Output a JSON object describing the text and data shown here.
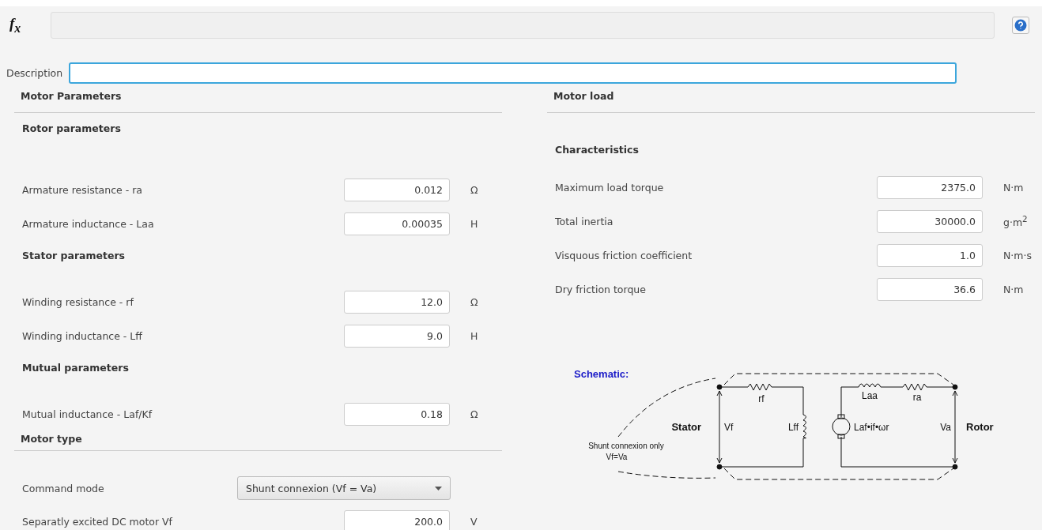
{
  "formula_bar": {
    "label": "f$_{x}$"
  },
  "description": {
    "label": "Description"
  },
  "left": {
    "title": "Motor Parameters",
    "items": [
      {
        "kind": "subheading",
        "label": "Rotor parameters"
      },
      {
        "kind": "field",
        "label": "Armature resistance - ra",
        "value": "0.012",
        "unit": "Ω"
      },
      {
        "kind": "field",
        "label": "Armature inductance - Laa",
        "value": "0.00035",
        "unit": "H"
      },
      {
        "kind": "subheading",
        "label": "Stator parameters"
      },
      {
        "kind": "field",
        "label": "Winding resistance - rf",
        "value": "12.0",
        "unit": "Ω"
      },
      {
        "kind": "field",
        "label": "Winding inductance - Lff",
        "value": "9.0",
        "unit": "H"
      },
      {
        "kind": "subheading",
        "label": "Mutual parameters"
      },
      {
        "kind": "field",
        "label": "Mutual inductance - Laf/Kf",
        "value": "0.18",
        "unit": "Ω"
      },
      {
        "kind": "heading",
        "label": "Motor type"
      },
      {
        "kind": "dropdown",
        "label": "Command mode",
        "value": "Shunt connexion (Vf = Va)"
      },
      {
        "kind": "field",
        "label": "Separatly excited DC motor Vf",
        "value": "200.0",
        "unit": "V"
      }
    ]
  },
  "right": {
    "title": "Motor load",
    "items": [
      {
        "kind": "subheading",
        "label": "Characteristics"
      },
      {
        "kind": "field",
        "label": "Maximum load torque",
        "value": "2375.0",
        "unit": "N·m"
      },
      {
        "kind": "field",
        "label": "Total inertia",
        "value": "30000.0",
        "unit": "g·m$^{2}$"
      },
      {
        "kind": "field",
        "label": "Visquous friction coefficient",
        "value": "1.0",
        "unit": "N·m·s"
      },
      {
        "kind": "field",
        "label": "Dry friction torque",
        "value": "36.6",
        "unit": "N·m"
      }
    ]
  },
  "schematic": {
    "title": "Schematic:",
    "rf": "rf",
    "laa": "Laa",
    "ra": "ra",
    "stator": "Stator",
    "vf": "Vf",
    "lff": "Lff",
    "laf": "Laf•if•ωr",
    "va": "Va",
    "rotor": "Rotor",
    "note_line_1": "Shunt connexion only",
    "note_line_2": "Vf=Va"
  }
}
